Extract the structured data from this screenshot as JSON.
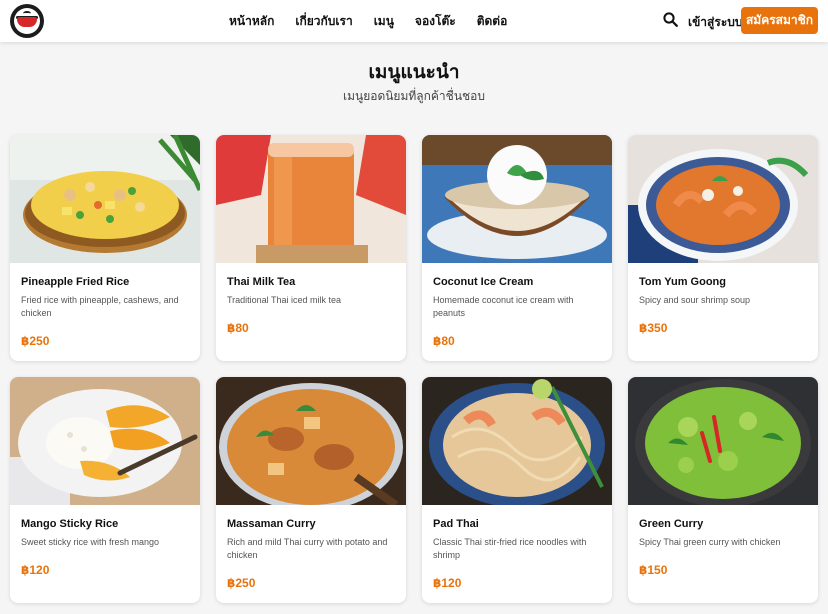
{
  "brand": {
    "logo_icon": "logo-bowl-icon",
    "accent_color": "#e8730c"
  },
  "nav": {
    "links": [
      "หน้าหลัก",
      "เกี่ยวกับเรา",
      "เมนู",
      "จองโต๊ะ",
      "ติดต่อ"
    ],
    "search_icon": "search-icon",
    "login_label": "เข้าสู่ระบบ",
    "signup_label": "สมัครสมาชิก"
  },
  "section": {
    "title": "เมนูแนะนำ",
    "subtitle": "เมนูยอดนิยมที่ลูกค้าชื่นชอบ"
  },
  "menu": [
    {
      "name": "Pineapple Fried Rice",
      "description": "Fried rice with pineapple, cashews, and chicken",
      "price": "฿250"
    },
    {
      "name": "Thai Milk Tea",
      "description": "Traditional Thai iced milk tea",
      "price": "฿80"
    },
    {
      "name": "Coconut Ice Cream",
      "description": "Homemade coconut ice cream with peanuts",
      "price": "฿80"
    },
    {
      "name": "Tom Yum Goong",
      "description": "Spicy and sour shrimp soup",
      "price": "฿350"
    },
    {
      "name": "Mango Sticky Rice",
      "description": "Sweet sticky rice with fresh mango",
      "price": "฿120"
    },
    {
      "name": "Massaman Curry",
      "description": "Rich and mild Thai curry with potato and chicken",
      "price": "฿250"
    },
    {
      "name": "Pad Thai",
      "description": "Classic Thai stir-fried rice noodles with shrimp",
      "price": "฿120"
    },
    {
      "name": "Green Curry",
      "description": "Spicy Thai green curry with chicken",
      "price": "฿150"
    }
  ]
}
